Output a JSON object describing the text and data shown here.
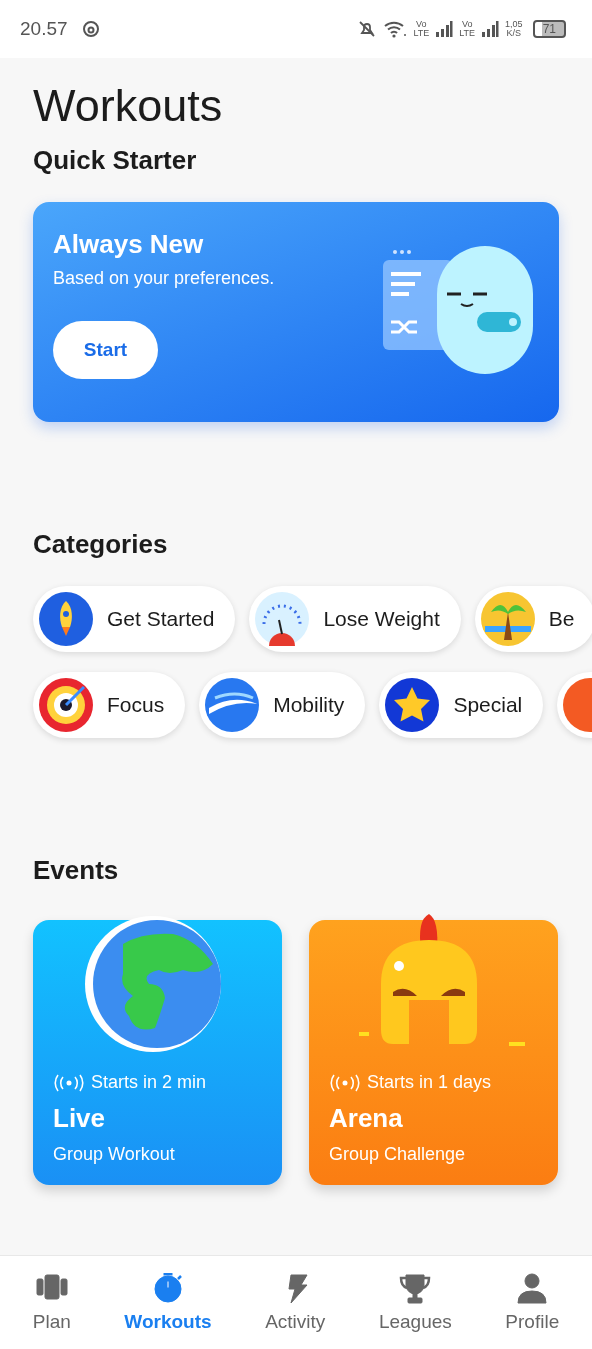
{
  "status_bar": {
    "time": "20.57",
    "network_labels": [
      {
        "top": "Vo",
        "bottom": "LTE"
      },
      {
        "top": "Vo",
        "bottom": "LTE"
      }
    ],
    "speed": {
      "value": "1,05",
      "unit": "K/S"
    },
    "battery": "71"
  },
  "title": "Workouts",
  "quick_starter": {
    "heading": "Quick Starter",
    "card": {
      "title": "Always New",
      "subtitle": "Based on your preferences.",
      "button": "Start"
    }
  },
  "categories": {
    "heading": "Categories",
    "rows": [
      [
        {
          "kind": "rocket",
          "label": "Get Started"
        },
        {
          "kind": "gauge",
          "label": "Lose Weight"
        },
        {
          "kind": "palm",
          "label": "Be"
        }
      ],
      [
        {
          "kind": "target",
          "label": "Focus"
        },
        {
          "kind": "swoosh",
          "label": "Mobility"
        },
        {
          "kind": "star",
          "label": "Special"
        },
        {
          "kind": "orange"
        }
      ]
    ]
  },
  "events": {
    "heading": "Events",
    "cards": [
      {
        "kind": "globe",
        "starts": "Starts in 2 min",
        "title": "Live",
        "subtitle": "Group Workout"
      },
      {
        "kind": "helmet",
        "starts": "Starts in 1 days",
        "title": "Arena",
        "subtitle": "Group Challenge"
      }
    ]
  },
  "nav": [
    {
      "kind": "plan",
      "label": "Plan",
      "selected": false
    },
    {
      "kind": "stopwatch",
      "label": "Workouts",
      "selected": true
    },
    {
      "kind": "bolt",
      "label": "Activity",
      "selected": false
    },
    {
      "kind": "trophy",
      "label": "Leagues",
      "selected": false
    },
    {
      "kind": "person",
      "label": "Profile",
      "selected": false
    }
  ]
}
